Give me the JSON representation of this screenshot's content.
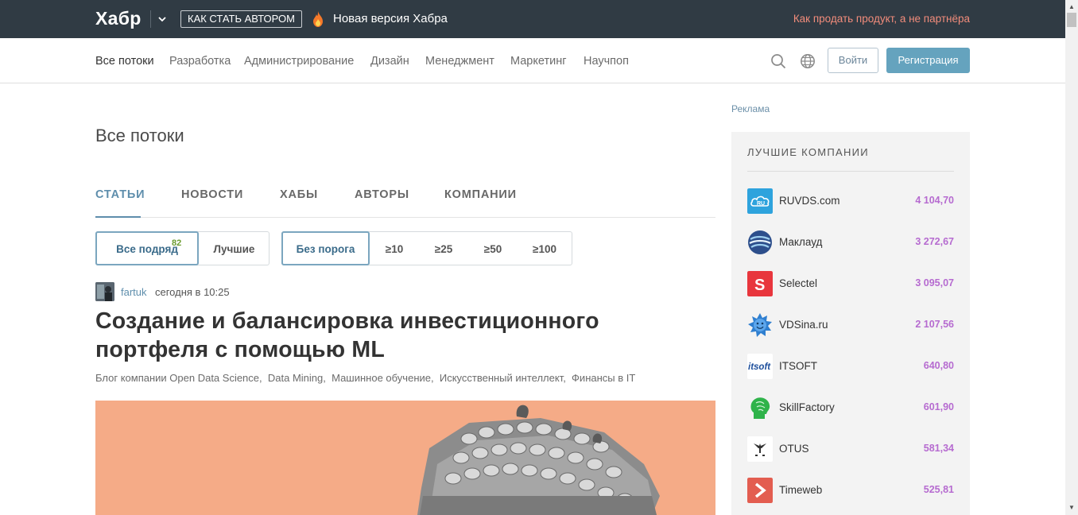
{
  "topbar": {
    "logo": "Хабр",
    "author_button": "КАК СТАТЬ АВТОРОМ",
    "new_version": "Новая версия Хабра",
    "promo": "Как продать продукт, а не партнёра"
  },
  "nav": {
    "items": [
      "Все потоки",
      "Разработка",
      "Администрирование",
      "Дизайн",
      "Менеджмент",
      "Маркетинг",
      "Научпоп"
    ],
    "login": "Войти",
    "register": "Регистрация"
  },
  "page": {
    "title": "Все потоки",
    "tabs": [
      "СТАТЬИ",
      "НОВОСТИ",
      "ХАБЫ",
      "АВТОРЫ",
      "КОМПАНИИ"
    ],
    "filter1": [
      "Все подряд",
      "Лучшие"
    ],
    "filter1_badge": "82",
    "filter2": [
      "Без порога",
      "≥10",
      "≥25",
      "≥50",
      "≥100"
    ]
  },
  "post": {
    "author": "fartuk",
    "time": "сегодня в 10:25",
    "title": "Создание и балансировка инвестиционного портфеля с помощью ML",
    "hubs": [
      "Блог компании Open Data Science,",
      "Data Mining,",
      "Машинное обучение,",
      "Искусственный интеллект,",
      "Финансы в IT"
    ]
  },
  "sidebar": {
    "ad_label": "Реклама",
    "title": "ЛУЧШИЕ КОМПАНИИ",
    "companies": [
      {
        "name": "RUVDS.com",
        "score": "4 104,70",
        "logo_color": "#2ea3dd"
      },
      {
        "name": "Маклауд",
        "score": "3 272,67",
        "logo_color": "#2d4f8c"
      },
      {
        "name": "Selectel",
        "score": "3 095,07",
        "logo_color": "#e8363d"
      },
      {
        "name": "VDSina.ru",
        "score": "2 107,56",
        "logo_color": "#2f7fd0"
      },
      {
        "name": "ITSOFT",
        "score": "640,80",
        "logo_color": "#1e4f9c"
      },
      {
        "name": "SkillFactory",
        "score": "601,90",
        "logo_color": "#2fb34a"
      },
      {
        "name": "OTUS",
        "score": "581,34",
        "logo_color": "#ffffff"
      },
      {
        "name": "Timeweb",
        "score": "525,81",
        "logo_color": "#e35d50"
      }
    ]
  }
}
